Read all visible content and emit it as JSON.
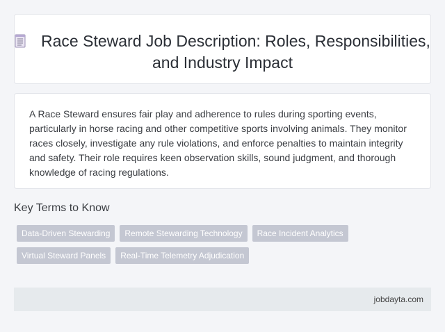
{
  "header": {
    "icon": "document-icon",
    "title": "Race Steward Job Description: Roles, Responsibilities, and Industry Impact"
  },
  "description": {
    "text": "A Race Steward ensures fair play and adherence to rules during sporting events, particularly in horse racing and other competitive sports involving animals. They monitor races closely, investigate any rule violations, and enforce penalties to maintain integrity and safety. Their role requires keen observation skills, sound judgment, and thorough knowledge of racing regulations."
  },
  "key_terms": {
    "heading": "Key Terms to Know",
    "tags": [
      "Data-Driven Stewarding",
      "Remote Stewarding Technology",
      "Race Incident Analytics",
      "Virtual Steward Panels",
      "Real-Time Telemetry Adjudication"
    ]
  },
  "footer": {
    "site": "jobdayta.com"
  },
  "colors": {
    "background": "#f4f5f8",
    "card": "#ffffff",
    "tag_bg": "#c4c7d2",
    "footer_bg": "#e6eaed"
  }
}
